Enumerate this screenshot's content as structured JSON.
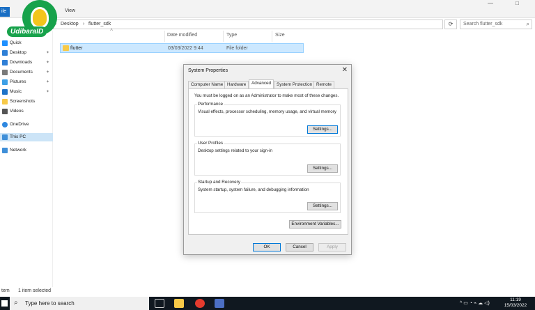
{
  "explorer": {
    "file_tab": "ile",
    "view_tab": "View",
    "minimize": "—",
    "maximize": "□",
    "close": "✕",
    "breadcrumb": [
      "Desktop",
      "flutter_sdk"
    ],
    "breadcrumb_sep": "›",
    "refresh_icon": "refresh-icon",
    "search_placeholder": "Search flutter_sdk",
    "columns": [
      "Date modified",
      "Type",
      "Size"
    ],
    "files": [
      {
        "name": "flutter",
        "date": "03/03/2022 9:44",
        "type": "File folder"
      }
    ],
    "status_left": "tem",
    "status_selected": "1 item selected"
  },
  "nav": {
    "items": [
      {
        "label": "Quick",
        "icon": "star-icon",
        "color": "#1e90ff",
        "pinned": false
      },
      {
        "label": "Desktop",
        "icon": "desktop-icon",
        "color": "#2f7fd6",
        "pinned": true
      },
      {
        "label": "Downloads",
        "icon": "download-icon",
        "color": "#2f7fd6",
        "pinned": true
      },
      {
        "label": "Documents",
        "icon": "document-icon",
        "color": "#7a7a7a",
        "pinned": true
      },
      {
        "label": "Pictures",
        "icon": "picture-icon",
        "color": "#3ea0e6",
        "pinned": true
      },
      {
        "label": "Music",
        "icon": "music-icon",
        "color": "#1e73c8",
        "pinned": true
      },
      {
        "label": "Screenshots",
        "icon": "folder-icon",
        "color": "#f7c948",
        "pinned": false
      },
      {
        "label": "Videos",
        "icon": "video-icon",
        "color": "#555555",
        "pinned": false
      },
      {
        "label": "OneDrive",
        "icon": "cloud-icon",
        "color": "#2f88e0",
        "pinned": false
      },
      {
        "label": "This PC",
        "icon": "computer-icon",
        "color": "#3f8fd8",
        "pinned": false,
        "selected": true
      },
      {
        "label": "Network",
        "icon": "network-icon",
        "color": "#3f8fd8",
        "pinned": false
      }
    ],
    "pin_glyph": "📌"
  },
  "logo": {
    "text": "UdibaraID"
  },
  "dialog": {
    "title": "System Properties",
    "close": "✕",
    "tabs": [
      "Computer Name",
      "Hardware",
      "Advanced",
      "System Protection",
      "Remote"
    ],
    "active_tab": "Advanced",
    "admin_note": "You must be logged on as an Administrator to make most of these changes.",
    "groups": [
      {
        "label": "Performance",
        "desc": "Visual effects, processor scheduling, memory usage, and virtual memory",
        "button": "Settings..."
      },
      {
        "label": "User Profiles",
        "desc": "Desktop settings related to your sign-in",
        "button": "Settings..."
      },
      {
        "label": "Startup and Recovery",
        "desc": "System startup, system failure, and debugging information",
        "button": "Settings..."
      }
    ],
    "env_button": "Environment Variables...",
    "ok": "OK",
    "cancel": "Cancel",
    "apply": "Apply"
  },
  "taskbar": {
    "search_placeholder": "Type here to search",
    "time": "11:19",
    "date": "15/03/2022",
    "tray": "^  ▭  ◔  ⌁  ☁  ◁)"
  }
}
